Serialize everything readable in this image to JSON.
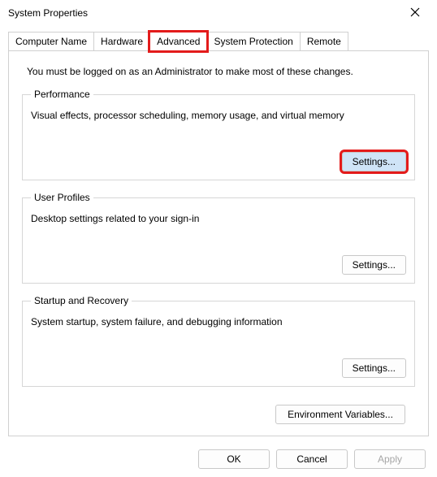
{
  "window": {
    "title": "System Properties"
  },
  "tabs": {
    "computer_name": "Computer Name",
    "hardware": "Hardware",
    "advanced": "Advanced",
    "system_protection": "System Protection",
    "remote": "Remote"
  },
  "intro": "You must be logged on as an Administrator to make most of these changes.",
  "performance": {
    "legend": "Performance",
    "desc": "Visual effects, processor scheduling, memory usage, and virtual memory",
    "button": "Settings..."
  },
  "user_profiles": {
    "legend": "User Profiles",
    "desc": "Desktop settings related to your sign-in",
    "button": "Settings..."
  },
  "startup": {
    "legend": "Startup and Recovery",
    "desc": "System startup, system failure, and debugging information",
    "button": "Settings..."
  },
  "env_button": "Environment Variables...",
  "footer": {
    "ok": "OK",
    "cancel": "Cancel",
    "apply": "Apply"
  }
}
